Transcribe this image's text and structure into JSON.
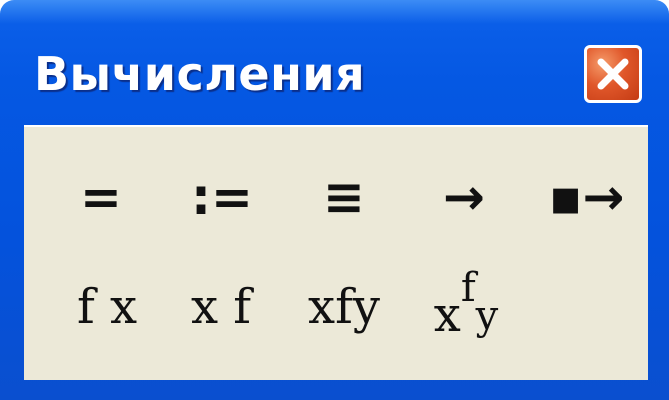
{
  "window": {
    "title": "Вычисления",
    "close_icon": "close-icon"
  },
  "palette": {
    "row1": [
      {
        "id": "equals",
        "symbol": "="
      },
      {
        "id": "define",
        "symbol": ":="
      },
      {
        "id": "global-define",
        "symbol": "≡"
      },
      {
        "id": "symbolic-eval",
        "symbol": "→"
      },
      {
        "id": "keyword-eval",
        "symbol": "▪→"
      }
    ],
    "row2": [
      {
        "id": "prefix-op",
        "symbol": "f x"
      },
      {
        "id": "postfix-op",
        "symbol": "x f"
      },
      {
        "id": "infix-op",
        "symbol": "xfy"
      },
      {
        "id": "treefix-op",
        "base": "x",
        "sup": "f",
        "sub": "y"
      }
    ]
  },
  "colors": {
    "titlebar": "#0558e3",
    "panel": "#ece9d8",
    "close": "#e0572a"
  }
}
